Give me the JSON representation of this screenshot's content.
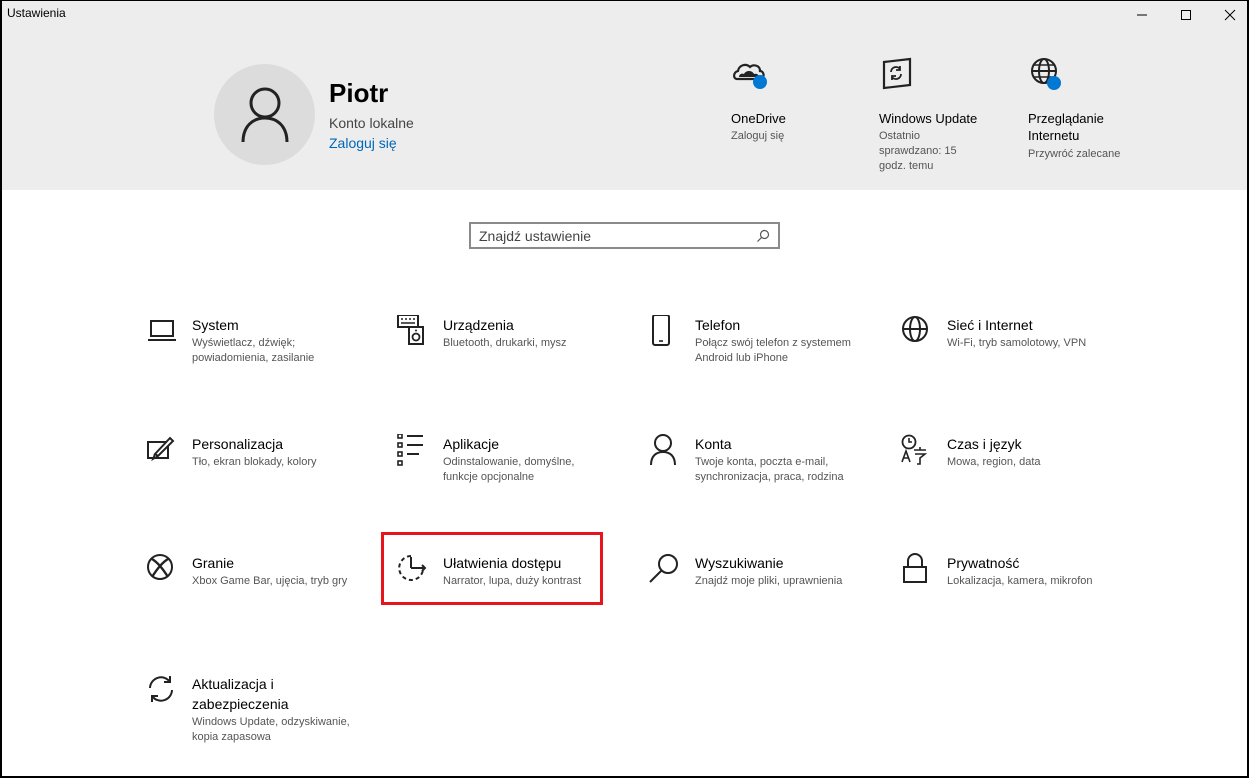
{
  "window": {
    "title": "Ustawienia"
  },
  "user": {
    "name": "Piotr",
    "account_type": "Konto lokalne",
    "sign_in_link": "Zaloguj się"
  },
  "quick_links": [
    {
      "icon": "onedrive-cloud-icon",
      "title": "OneDrive",
      "subtitle": "Zaloguj się"
    },
    {
      "icon": "windows-update-icon",
      "title": "Windows Update",
      "subtitle": "Ostatnio sprawdzano: 15 godz. temu",
      "subtitle_lines": [
        "Ostatnio",
        "sprawdzano: 15",
        "godz. temu"
      ]
    },
    {
      "icon": "globe-browsing-icon",
      "title": "Przeglądanie Internetu",
      "title_lines": [
        "Przeglądanie",
        "Internetu"
      ],
      "subtitle": "Przywróć zalecane"
    }
  ],
  "search": {
    "placeholder": "Znajdź ustawienie"
  },
  "categories": [
    {
      "icon": "laptop-icon",
      "title": "System",
      "desc": "Wyświetlacz, dźwięk; powiadomienia, zasilanie",
      "desc_lines": [
        "Wyświetlacz, dźwięk;",
        "powiadomienia, zasilanie"
      ]
    },
    {
      "icon": "devices-icon",
      "title": "Urządzenia",
      "desc": "Bluetooth, drukarki, mysz",
      "desc_lines": [
        "Bluetooth, drukarki, mysz"
      ]
    },
    {
      "icon": "phone-icon",
      "title": "Telefon",
      "desc": "Połącz swój telefon z systemem Android lub iPhone",
      "desc_lines": [
        "Połącz swój telefon z systemem",
        "Android lub iPhone"
      ]
    },
    {
      "icon": "globe-icon",
      "title": "Sieć i Internet",
      "desc": "Wi-Fi, tryb samolotowy, VPN",
      "desc_lines": [
        "Wi-Fi, tryb samolotowy, VPN"
      ]
    },
    {
      "icon": "personalization-icon",
      "title": "Personalizacja",
      "desc": "Tło, ekran blokady, kolory",
      "desc_lines": [
        "Tło, ekran blokady, kolory"
      ]
    },
    {
      "icon": "apps-list-icon",
      "title": "Aplikacje",
      "desc": "Odinstalowanie, domyślne, funkcje opcjonalne",
      "desc_lines": [
        "Odinstalowanie, domyślne,",
        "funkcje opcjonalne"
      ]
    },
    {
      "icon": "person-icon",
      "title": "Konta",
      "desc": "Twoje konta, poczta e-mail, synchronizacja, praca, rodzina",
      "desc_lines": [
        "Twoje konta, poczta e-mail,",
        "synchronizacja, praca, rodzina"
      ]
    },
    {
      "icon": "time-language-icon",
      "title": "Czas i język",
      "desc": "Mowa, region, data",
      "desc_lines": [
        "Mowa, region, data"
      ]
    },
    {
      "icon": "xbox-icon",
      "title": "Granie",
      "desc": "Xbox Game Bar, ujęcia, tryb gry",
      "desc_lines": [
        "Xbox Game Bar, ujęcia, tryb gry"
      ]
    },
    {
      "icon": "ease-of-access-icon",
      "title": "Ułatwienia dostępu",
      "desc": "Narrator, lupa, duży kontrast",
      "desc_lines": [
        "Narrator, lupa, duży kontrast"
      ]
    },
    {
      "icon": "search-icon",
      "title": "Wyszukiwanie",
      "desc": "Znajdź moje pliki, uprawnienia",
      "desc_lines": [
        "Znajdź moje pliki, uprawnienia"
      ]
    },
    {
      "icon": "lock-icon",
      "title": "Prywatność",
      "desc": "Lokalizacja, kamera, mikrofon",
      "desc_lines": [
        "Lokalizacja, kamera, mikrofon"
      ]
    },
    {
      "icon": "sync-update-icon",
      "title": "Aktualizacja i zabezpieczenia",
      "title_lines": [
        "Aktualizacja i",
        "zabezpieczenia"
      ],
      "desc": "Windows Update, odzyskiwanie, kopia zapasowa",
      "desc_lines": [
        "Windows Update, odzyskiwanie,",
        "kopia zapasowa"
      ]
    }
  ],
  "colors": {
    "accent": "#0067b8",
    "badge_blue": "#0078d4",
    "header_bg": "#ededed",
    "highlight_red": "#e8141b"
  }
}
